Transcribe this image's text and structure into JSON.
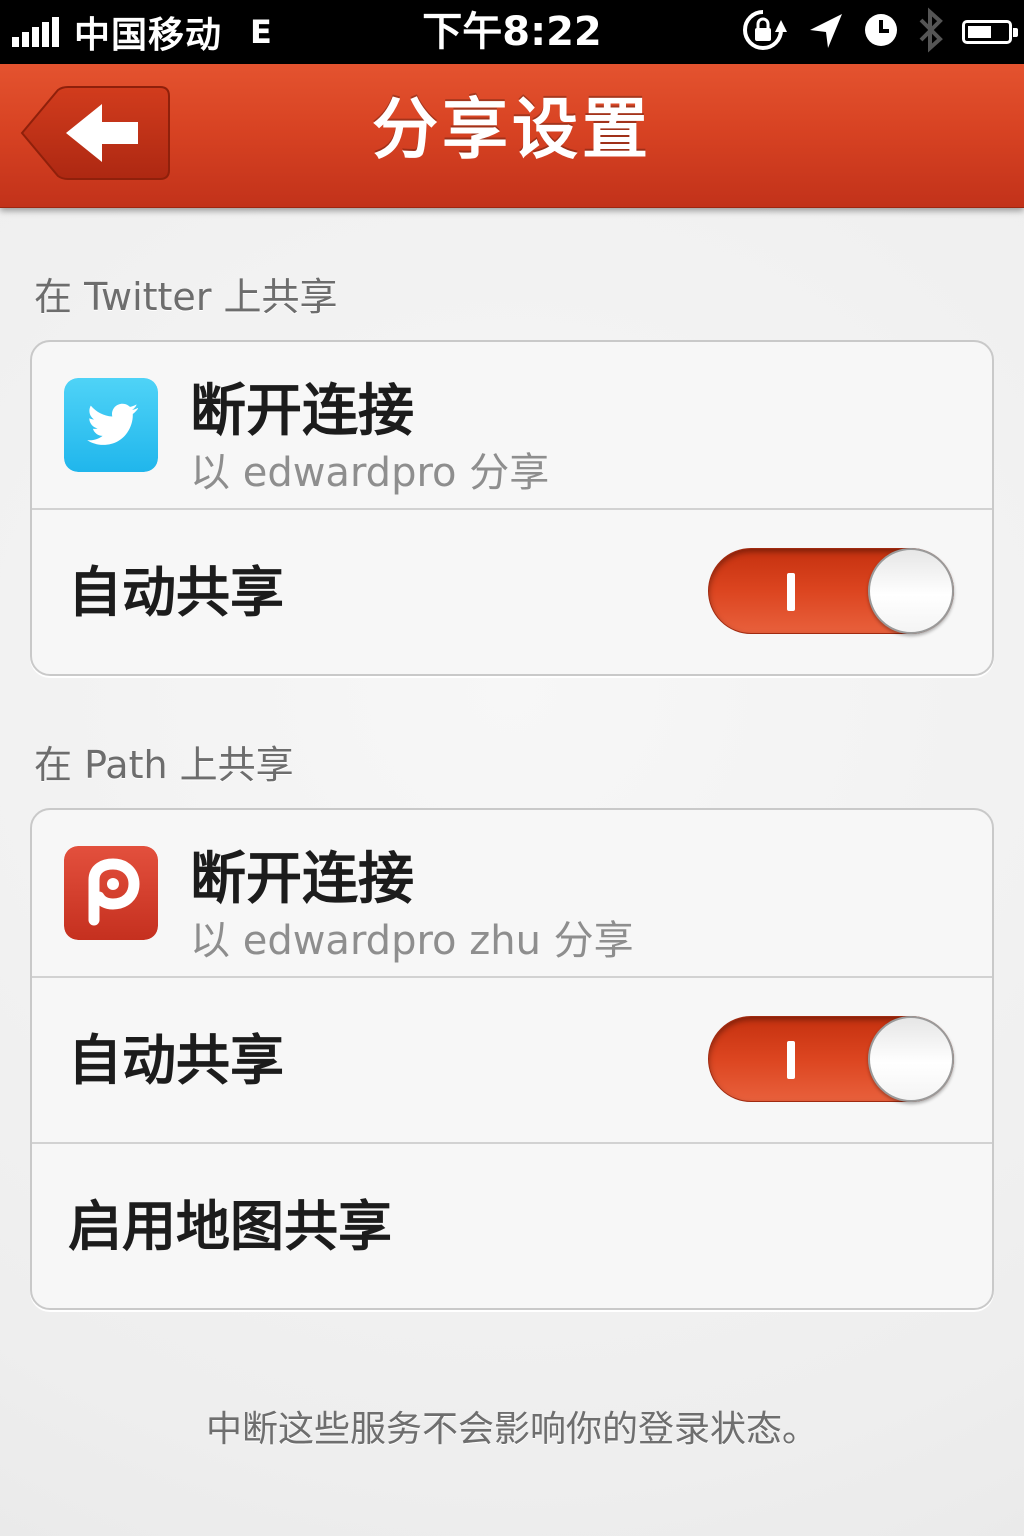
{
  "status_bar": {
    "carrier": "中国移动",
    "network": "E",
    "time": "下午8:22",
    "icons": [
      "signal-icon",
      "rotation-lock-icon",
      "location-icon",
      "alarm-icon",
      "bluetooth-icon",
      "battery-icon"
    ],
    "battery_level": 0.6
  },
  "nav": {
    "title": "分享设置",
    "back_icon": "back-arrow-icon",
    "color": "#d84323"
  },
  "twitter_section": {
    "header": "在 Twitter 上共享",
    "account": {
      "icon": "twitter-icon",
      "title": "断开连接",
      "subtitle": "以 edwardpro 分享"
    },
    "auto_share": {
      "label": "自动共享",
      "enabled": true
    }
  },
  "path_section": {
    "header": "在 Path 上共享",
    "account": {
      "icon": "path-icon",
      "title": "断开连接",
      "subtitle": "以 edwardpro zhu 分享"
    },
    "auto_share": {
      "label": "自动共享",
      "enabled": true
    },
    "map_share": {
      "label": "启用地图共享"
    }
  },
  "footer_note": "中断这些服务不会影响你的登录状态。",
  "colors": {
    "accent": "#d84323",
    "twitter_blue": "#2fc2ef",
    "path_red": "#d23b2c"
  }
}
